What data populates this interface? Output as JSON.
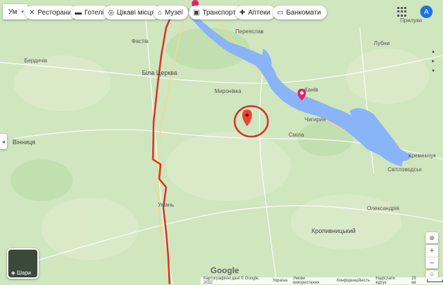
{
  "search": {
    "text": "Ум"
  },
  "categories": [
    {
      "icon": "restaurant-icon",
      "glyph": "🍴",
      "label": "Ресторани"
    },
    {
      "icon": "hotel-icon",
      "glyph": "🛏",
      "label": "Готелі"
    },
    {
      "icon": "attraction-icon",
      "glyph": "📷",
      "label": "Цікаві місця"
    },
    {
      "icon": "museum-icon",
      "glyph": "🏛",
      "label": "Музеї"
    },
    {
      "icon": "transit-icon",
      "glyph": "🚆",
      "label": "Транспорт"
    },
    {
      "icon": "pharmacy-icon",
      "glyph": "💊",
      "label": "Аптеки"
    },
    {
      "icon": "atm-icon",
      "glyph": "💳",
      "label": "Банкомати"
    }
  ],
  "apps_icon": "apps-grid-icon",
  "account": {
    "initial": "A",
    "color": "#1a73e8"
  },
  "map_labels": {
    "fastiv": "Фастів",
    "bila_tserkva": "Біла Церква",
    "myronivka": "Миронівка",
    "vinnytsia": "Вінниця",
    "smila": "Сміла",
    "kremenchuk": "Кременчук",
    "svitlovodsk": "Світловодськ",
    "kropyvnytskyi": "Кропивницький",
    "oleksandriia": "Олександрія",
    "uman": "Умань",
    "berdychiv": "Бердичів",
    "pereiaslav": "Переяслав",
    "chyhyryn": "Чигирин",
    "lubny": "Лубни",
    "kaniv": "Канів",
    "pryluky": "Прилуки"
  },
  "layers": {
    "label": "Шари"
  },
  "zoom": {
    "in": "+",
    "out": "−"
  },
  "logo": "Google",
  "footer": {
    "attribution": "Картографічні дані © Google, 2022",
    "ukraine": "Україна",
    "terms": "Умови використання",
    "privacy": "Конфіденційність",
    "feedback": "Надіслати відгук",
    "scale": "20 км"
  },
  "colors": {
    "water": "#8ab4f8",
    "route": "#d93025",
    "marker": "#ea4335",
    "land": "#cfe6bf"
  }
}
